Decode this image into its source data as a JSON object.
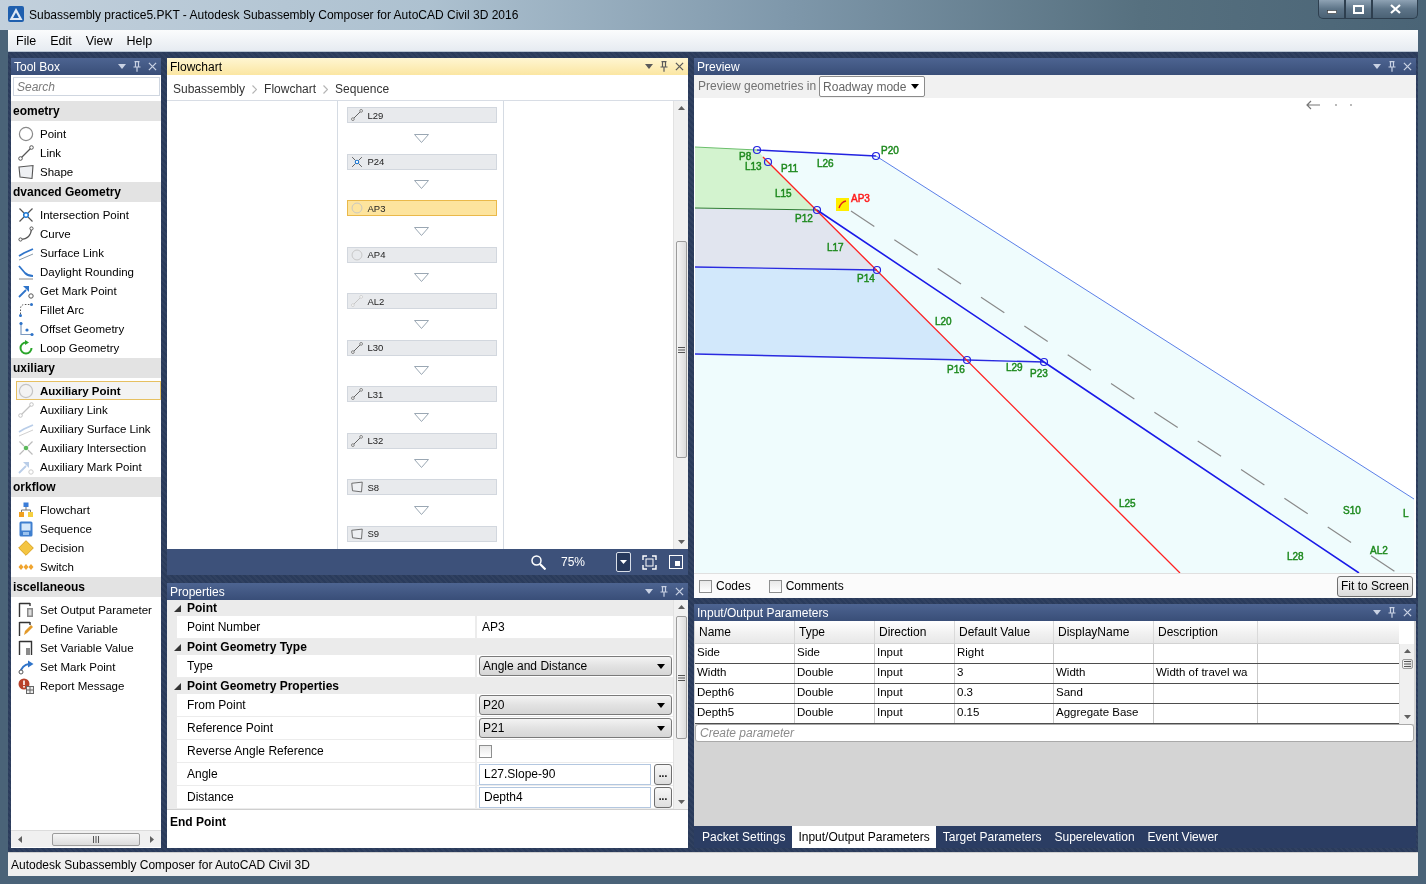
{
  "window": {
    "title": "Subassembly practice5.PKT - Autodesk Subassembly Composer for AutoCAD Civil 3D 2016"
  },
  "menu": [
    {
      "label": "File"
    },
    {
      "label": "Edit"
    },
    {
      "label": "View"
    },
    {
      "label": "Help"
    }
  ],
  "toolbox": {
    "title": "Tool Box",
    "focused": false,
    "search": {
      "placeholder": "Search"
    },
    "categories": [
      {
        "name": "eometry",
        "items": [
          {
            "label": "Point",
            "selected": false
          },
          {
            "label": "Link",
            "selected": false
          },
          {
            "label": "Shape",
            "selected": false
          }
        ]
      },
      {
        "name": "dvanced Geometry",
        "items": [
          {
            "label": "Intersection Point",
            "selected": false
          },
          {
            "label": "Curve",
            "selected": false
          },
          {
            "label": "Surface Link",
            "selected": false
          },
          {
            "label": "Daylight Rounding",
            "selected": false
          },
          {
            "label": "Get Mark Point",
            "selected": false
          },
          {
            "label": "Fillet Arc",
            "selected": false
          },
          {
            "label": "Offset Geometry",
            "selected": false
          },
          {
            "label": "Loop Geometry",
            "selected": false
          }
        ]
      },
      {
        "name": "uxiliary",
        "items": [
          {
            "label": "Auxiliary Point",
            "selected": true
          },
          {
            "label": "Auxiliary Link",
            "selected": false
          },
          {
            "label": "Auxiliary Surface Link",
            "selected": false
          },
          {
            "label": "Auxiliary Intersection",
            "selected": false
          },
          {
            "label": "Auxiliary Mark Point",
            "selected": false
          }
        ]
      },
      {
        "name": "orkflow",
        "items": [
          {
            "label": "Flowchart",
            "selected": false
          },
          {
            "label": "Sequence",
            "selected": false
          },
          {
            "label": "Decision",
            "selected": false
          },
          {
            "label": "Switch",
            "selected": false
          }
        ]
      },
      {
        "name": "iscellaneous",
        "items": [
          {
            "label": "Set Output Parameter",
            "selected": false
          },
          {
            "label": "Define Variable",
            "selected": false
          },
          {
            "label": "Set Variable Value",
            "selected": false
          },
          {
            "label": "Set Mark Point",
            "selected": false
          },
          {
            "label": "Report Message",
            "selected": false
          }
        ]
      }
    ]
  },
  "flowchart": {
    "title": "Flowchart",
    "focused": true,
    "breadcrumb": [
      "Subassembly",
      "Flowchart",
      "Sequence"
    ],
    "nodes": [
      {
        "label": "L29",
        "kind": "link",
        "selected": false
      },
      {
        "label": "P24",
        "kind": "intersection_point",
        "selected": false
      },
      {
        "label": "AP3",
        "kind": "auxiliary_point",
        "selected": true
      },
      {
        "label": "AP4",
        "kind": "auxiliary_point",
        "selected": false
      },
      {
        "label": "AL2",
        "kind": "auxiliary_link",
        "selected": false
      },
      {
        "label": "L30",
        "kind": "link",
        "selected": false
      },
      {
        "label": "L31",
        "kind": "link",
        "selected": false
      },
      {
        "label": "L32",
        "kind": "link",
        "selected": false
      },
      {
        "label": "S8",
        "kind": "shape",
        "selected": false
      },
      {
        "label": "S9",
        "kind": "shape",
        "selected": false
      }
    ],
    "zoom": "75%"
  },
  "properties": {
    "title": "Properties",
    "focused": false,
    "categories": [
      {
        "name": "Point",
        "expanded": true,
        "rows": [
          {
            "kind": "text",
            "label": "Point Number",
            "value": "AP3"
          }
        ]
      },
      {
        "name": "Point Geometry Type",
        "expanded": true,
        "rows": [
          {
            "kind": "dropdown",
            "label": "Type",
            "value": "Angle and Distance"
          }
        ]
      },
      {
        "name": "Point Geometry Properties",
        "expanded": true,
        "rows": [
          {
            "kind": "dropdown",
            "label": "From Point",
            "value": "P20"
          },
          {
            "kind": "dropdown",
            "label": "Reference Point",
            "value": "P21"
          },
          {
            "kind": "checkbox",
            "label": "Reverse Angle Reference",
            "checked": false
          },
          {
            "kind": "expression",
            "label": "Angle",
            "value": "L27.Slope-90",
            "button": "..."
          },
          {
            "kind": "expression",
            "label": "Distance",
            "value": "Depth4",
            "button": "..."
          }
        ]
      }
    ],
    "description_title": "End Point"
  },
  "preview": {
    "title": "Preview",
    "focused": false,
    "mode_label": "Preview geometries in",
    "mode": "Roadway mode",
    "labels": [
      {
        "text": "P8",
        "color": "#1f8a1f"
      },
      {
        "text": "L13",
        "color": "#1f8a1f"
      },
      {
        "text": "P11",
        "color": "#1f8a1f"
      },
      {
        "text": "L26",
        "color": "#1f8a1f"
      },
      {
        "text": "P20",
        "color": "#1f8a1f"
      },
      {
        "text": "L15",
        "color": "#1f8a1f"
      },
      {
        "text": "AP3",
        "color": "#ff1a1a"
      },
      {
        "text": "P12",
        "color": "#1f8a1f"
      },
      {
        "text": "L17",
        "color": "#1f8a1f"
      },
      {
        "text": "P14",
        "color": "#1f8a1f"
      },
      {
        "text": "L20",
        "color": "#1f8a1f"
      },
      {
        "text": "P16",
        "color": "#1f8a1f"
      },
      {
        "text": "L29",
        "color": "#1f8a1f"
      },
      {
        "text": "P23",
        "color": "#1f8a1f"
      },
      {
        "text": "L25",
        "color": "#1f8a1f"
      },
      {
        "text": "S10",
        "color": "#1f8a1f"
      },
      {
        "text": "L",
        "color": "#1f8a1f"
      },
      {
        "text": "L28",
        "color": "#1f8a1f"
      },
      {
        "text": "AL2",
        "color": "#1f8a1f"
      }
    ],
    "codes": {
      "label": "Codes",
      "checked": false
    },
    "comments": {
      "label": "Comments",
      "checked": false
    },
    "fit_button": "Fit to Screen"
  },
  "io_parameters": {
    "title": "Input/Output Parameters",
    "focused": false,
    "columns": [
      "Name",
      "Type",
      "Direction",
      "Default Value",
      "DisplayName",
      "Description"
    ],
    "rows": [
      {
        "name": "Side",
        "type": "Side",
        "direction": "Input",
        "default_value": "Right"
      },
      {
        "name": "Width",
        "type": "Double",
        "direction": "Input",
        "default_value": "3",
        "display_name": "Width",
        "description": "Width of travel wa"
      },
      {
        "name": "Depth6",
        "type": "Double",
        "direction": "Input",
        "default_value": "0.3",
        "display_name": "Sand"
      },
      {
        "name": "Depth5",
        "type": "Double",
        "direction": "Input",
        "default_value": "0.15",
        "display_name": "Aggregate Base"
      }
    ],
    "create_field": {
      "placeholder": "Create parameter"
    },
    "tabs": [
      {
        "label": "Packet Settings",
        "selected": false
      },
      {
        "label": "Input/Output Parameters",
        "selected": true
      },
      {
        "label": "Target Parameters",
        "selected": false
      },
      {
        "label": "Superelevation",
        "selected": false
      },
      {
        "label": "Event Viewer",
        "selected": false
      }
    ]
  },
  "status_bar": "Autodesk Subassembly Composer for AutoCAD Civil 3D"
}
